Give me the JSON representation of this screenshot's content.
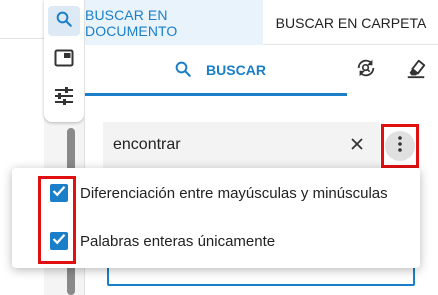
{
  "sidebar": {
    "buttons": [
      {
        "icon": "search-icon",
        "active": true
      },
      {
        "icon": "panel-icon",
        "active": false
      },
      {
        "icon": "sliders-icon",
        "active": false
      }
    ]
  },
  "tabs": [
    {
      "label": "BUSCAR EN DOCUMENTO",
      "active": true
    },
    {
      "label": "BUSCAR EN CARPETA",
      "active": false
    }
  ],
  "toolbar": {
    "search_label": "BUSCAR",
    "search_icon": "search-icon",
    "replace_icon": "search-replace-icon",
    "clear_icon": "eraser-icon"
  },
  "search": {
    "value": "encontrar",
    "clear_icon": "close-icon",
    "more_icon": "more-vert-icon"
  },
  "options_menu": {
    "items": [
      {
        "label": "Diferenciación entre mayúsculas y minúsculas",
        "checked": true
      },
      {
        "label": "Palabras enteras únicamente",
        "checked": true
      }
    ]
  },
  "colors": {
    "accent": "#1a7fc8",
    "highlight": "#e01010"
  }
}
